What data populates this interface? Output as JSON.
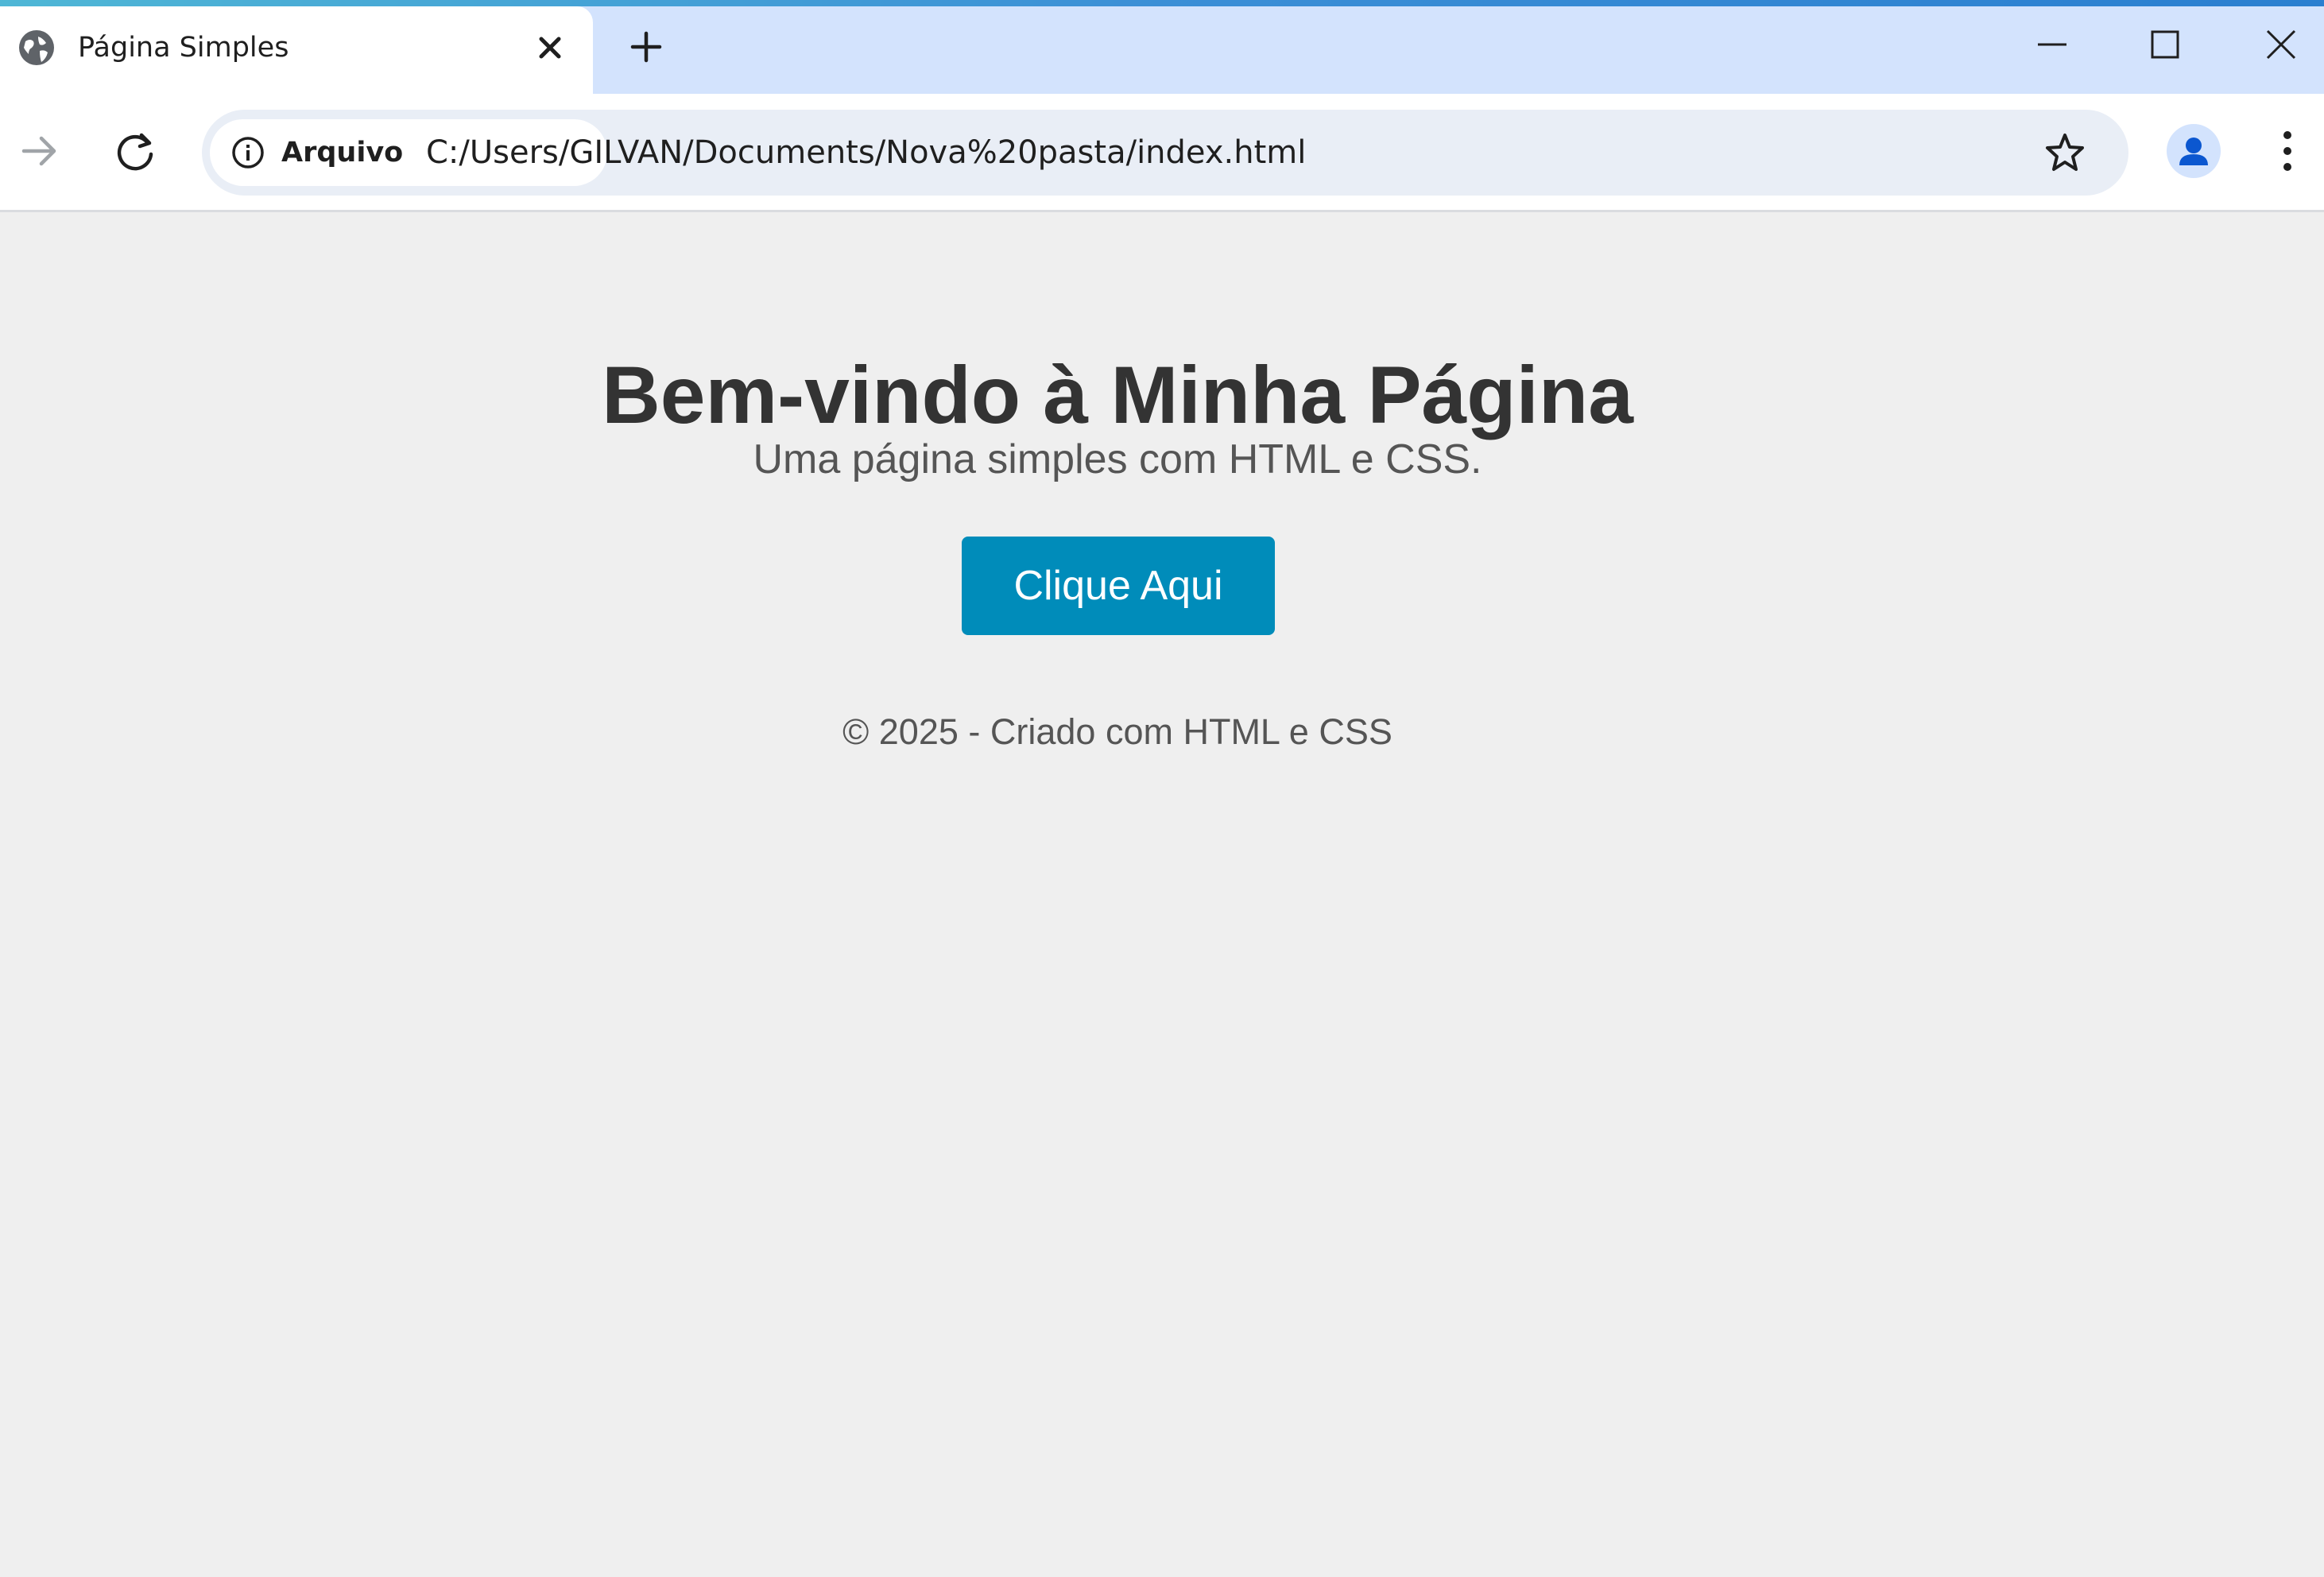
{
  "browser": {
    "tab": {
      "title": "Página Simples",
      "favicon": "globe-icon"
    },
    "new_tab_icon": "plus-icon",
    "window_controls": [
      "minimize-icon",
      "maximize-icon",
      "close-icon"
    ],
    "address_bar": {
      "security_chip_label": "Arquivo",
      "security_icon": "info-icon",
      "url": "C:/Users/GILVAN/Documents/Nova%20pasta/index.html"
    },
    "accent_colors": {
      "tabstrip": "#d3e3fd",
      "omnibox": "#e9eef6",
      "avatar": "#0b57d0"
    }
  },
  "page": {
    "heading": "Bem-vindo à Minha Página",
    "subtitle": "Uma página simples com HTML e CSS.",
    "button_label": "Clique Aqui",
    "footer": "© 2025 - Criado com HTML e CSS",
    "colors": {
      "background": "#efefef",
      "button": "#008cba",
      "heading": "#333333",
      "text": "#555555"
    }
  }
}
